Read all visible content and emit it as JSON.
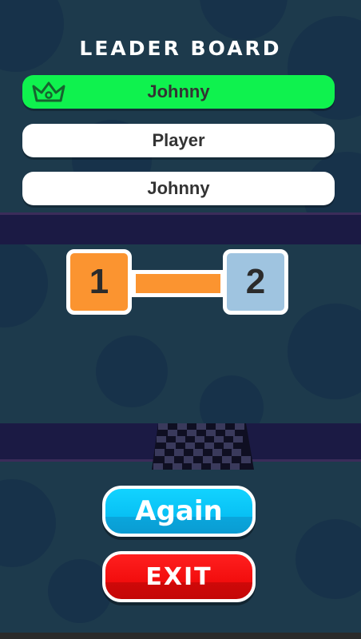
{
  "leaderboard": {
    "title": "LEADER BOARD",
    "entries": [
      {
        "name": "Johnny",
        "highlight": true
      },
      {
        "name": "Player",
        "highlight": false
      },
      {
        "name": "Johnny",
        "highlight": false
      }
    ]
  },
  "progress": {
    "from_level": "1",
    "to_level": "2",
    "from_color": "#fb9430",
    "to_color": "#9fc4e0"
  },
  "buttons": {
    "again_label": "Again",
    "exit_label": "EXIT"
  },
  "colors": {
    "winner": "#0ff24e",
    "again": "#08c0f4",
    "exit": "#f20d0d",
    "background": "#1d3a4c"
  },
  "icons": {
    "winner_marker": "crown-icon"
  }
}
